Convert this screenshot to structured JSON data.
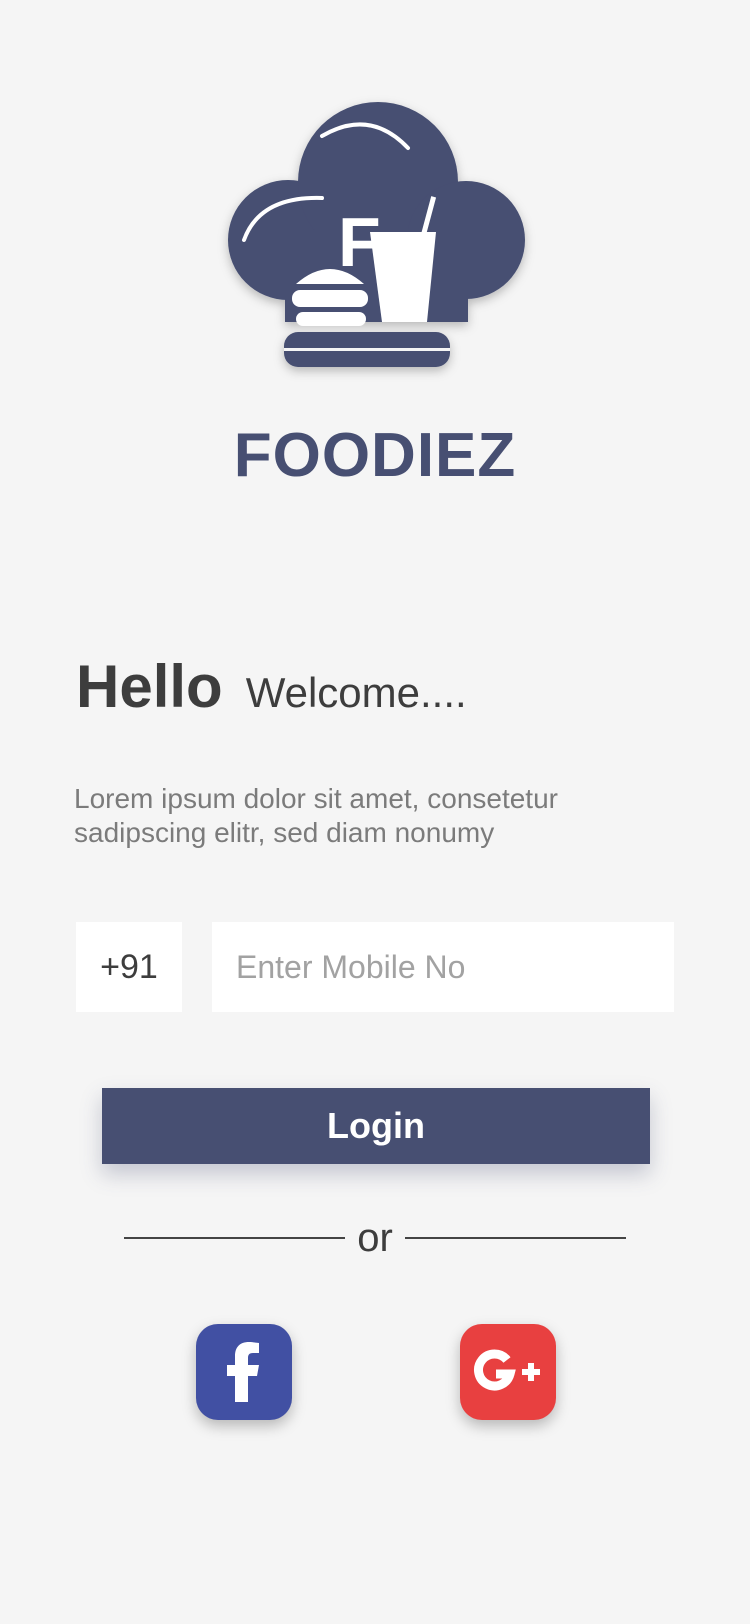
{
  "app": {
    "name": "FOODIEZ",
    "logo_icon": "chef-hat-burger-drink-icon",
    "logo_letter": "F"
  },
  "greeting": {
    "hello": "Hello",
    "welcome": "Welcome...."
  },
  "description": "Lorem ipsum dolor sit amet, consetetur sadipscing elitr, sed diam nonumy",
  "form": {
    "country_code": "+91",
    "mobile_placeholder": "Enter Mobile No",
    "mobile_value": ""
  },
  "login_label": "Login",
  "divider_text": "or",
  "social": {
    "facebook_icon": "facebook-icon",
    "google_plus_icon": "google-plus-icon"
  },
  "colors": {
    "brand": "#474f72",
    "background": "#f5f5f5",
    "facebook": "#4150a3",
    "google_plus": "#e84040"
  }
}
